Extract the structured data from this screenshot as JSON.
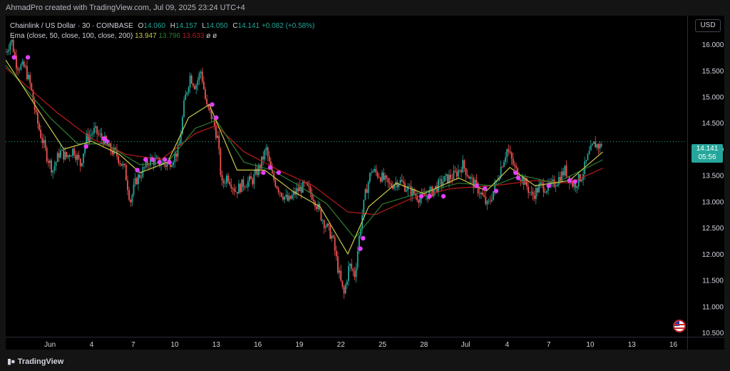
{
  "attribution": "AhmadPro created with TradingView.com, Jul 09, 2025 23:24 UTC+4",
  "legend": {
    "symbol": "Chainlink / US Dollar · 30 · COINBASE",
    "o_label": "O",
    "o_value": "14.060",
    "h_label": "H",
    "h_value": "14.157",
    "l_label": "L",
    "l_value": "14.050",
    "c_label": "C",
    "c_value": "14.141",
    "change": "+0.082 (+0.58%)",
    "ema_label": "Ema (close, 50, close, 100, close, 200)",
    "ema_50": "13.947",
    "ema_100": "13.796",
    "ema_200": "13.633",
    "ema_extra_1": "ø",
    "ema_extra_2": "ø"
  },
  "currency_button": "USD",
  "current_price": "14.141",
  "countdown": "05:56",
  "logo_text": "TradingView",
  "colors": {
    "up": "#26a69a",
    "down": "#ef5350",
    "ema_50": "#c8c84a",
    "ema_100": "#2e7d32",
    "ema_200": "#b71c1c",
    "marker": "#e040fb",
    "price_line": "#26a69a"
  },
  "chart_data": {
    "type": "candlestick",
    "symbol": "LINK/USD",
    "interval": "30",
    "exchange": "COINBASE",
    "y_ticks": [
      10.5,
      11.0,
      11.5,
      12.0,
      12.5,
      13.0,
      13.5,
      14.0,
      14.5,
      15.0,
      15.5,
      16.0
    ],
    "y_tick_labels": [
      "10.500",
      "11.000",
      "11.500",
      "12.000",
      "12.500",
      "13.000",
      "13.500",
      "14.000",
      "14.500",
      "15.000",
      "15.500",
      "16.000"
    ],
    "x_tick_labels": [
      "Jun",
      "4",
      "7",
      "10",
      "13",
      "16",
      "19",
      "22",
      "25",
      "28",
      "Jul",
      "4",
      "7",
      "10",
      "13",
      "16"
    ],
    "x_tick_days": [
      1,
      4,
      7,
      10,
      13,
      16,
      19,
      22,
      25,
      28,
      31,
      34,
      37,
      40,
      43,
      46
    ],
    "x_range_days": [
      -2.2,
      47
    ],
    "y_range": [
      10.42,
      16.3
    ],
    "close_path": [
      {
        "day": -2.2,
        "close": 15.85
      },
      {
        "day": -1.8,
        "close": 16.1
      },
      {
        "day": -1.4,
        "close": 15.6
      },
      {
        "day": -0.8,
        "close": 15.55
      },
      {
        "day": -0.4,
        "close": 15.2
      },
      {
        "day": 0.0,
        "close": 14.6
      },
      {
        "day": 0.4,
        "close": 14.2
      },
      {
        "day": 0.8,
        "close": 13.85
      },
      {
        "day": 1.2,
        "close": 13.6
      },
      {
        "day": 1.7,
        "close": 13.95
      },
      {
        "day": 2.2,
        "close": 13.85
      },
      {
        "day": 2.7,
        "close": 14.0
      },
      {
        "day": 3.2,
        "close": 13.7
      },
      {
        "day": 3.6,
        "close": 14.2
      },
      {
        "day": 4.2,
        "close": 14.35
      },
      {
        "day": 4.8,
        "close": 14.2
      },
      {
        "day": 5.3,
        "close": 14.0
      },
      {
        "day": 5.8,
        "close": 13.9
      },
      {
        "day": 6.4,
        "close": 13.6
      },
      {
        "day": 6.8,
        "close": 13.0
      },
      {
        "day": 7.2,
        "close": 13.4
      },
      {
        "day": 7.6,
        "close": 13.55
      },
      {
        "day": 8.2,
        "close": 13.8
      },
      {
        "day": 8.8,
        "close": 13.75
      },
      {
        "day": 9.4,
        "close": 13.7
      },
      {
        "day": 9.8,
        "close": 13.8
      },
      {
        "day": 10.3,
        "close": 14.0
      },
      {
        "day": 10.7,
        "close": 14.9
      },
      {
        "day": 11.1,
        "close": 15.4
      },
      {
        "day": 11.5,
        "close": 15.2
      },
      {
        "day": 11.9,
        "close": 15.5
      },
      {
        "day": 12.3,
        "close": 14.8
      },
      {
        "day": 12.7,
        "close": 14.6
      },
      {
        "day": 13.1,
        "close": 14.2
      },
      {
        "day": 13.4,
        "close": 13.3
      },
      {
        "day": 13.8,
        "close": 13.5
      },
      {
        "day": 14.4,
        "close": 13.2
      },
      {
        "day": 15.0,
        "close": 13.35
      },
      {
        "day": 15.6,
        "close": 13.4
      },
      {
        "day": 16.2,
        "close": 13.7
      },
      {
        "day": 16.6,
        "close": 14.0
      },
      {
        "day": 17.0,
        "close": 13.5
      },
      {
        "day": 17.6,
        "close": 13.2
      },
      {
        "day": 18.2,
        "close": 13.0
      },
      {
        "day": 18.8,
        "close": 13.2
      },
      {
        "day": 19.4,
        "close": 13.3
      },
      {
        "day": 20.0,
        "close": 13.1
      },
      {
        "day": 20.6,
        "close": 12.7
      },
      {
        "day": 21.0,
        "close": 12.5
      },
      {
        "day": 21.4,
        "close": 12.3
      },
      {
        "day": 21.8,
        "close": 11.7
      },
      {
        "day": 22.2,
        "close": 11.2
      },
      {
        "day": 22.6,
        "close": 11.8
      },
      {
        "day": 23.0,
        "close": 11.6
      },
      {
        "day": 23.4,
        "close": 12.5
      },
      {
        "day": 23.8,
        "close": 13.2
      },
      {
        "day": 24.2,
        "close": 13.6
      },
      {
        "day": 24.8,
        "close": 13.5
      },
      {
        "day": 25.5,
        "close": 13.3
      },
      {
        "day": 26.2,
        "close": 13.4
      },
      {
        "day": 27.0,
        "close": 13.2
      },
      {
        "day": 27.8,
        "close": 13.05
      },
      {
        "day": 28.6,
        "close": 13.2
      },
      {
        "day": 29.4,
        "close": 13.4
      },
      {
        "day": 30.2,
        "close": 13.5
      },
      {
        "day": 30.8,
        "close": 13.7
      },
      {
        "day": 31.4,
        "close": 13.4
      },
      {
        "day": 32.0,
        "close": 13.2
      },
      {
        "day": 32.6,
        "close": 12.9
      },
      {
        "day": 33.0,
        "close": 13.2
      },
      {
        "day": 33.6,
        "close": 13.7
      },
      {
        "day": 34.0,
        "close": 14.0
      },
      {
        "day": 34.6,
        "close": 13.6
      },
      {
        "day": 35.2,
        "close": 13.4
      },
      {
        "day": 35.8,
        "close": 13.1
      },
      {
        "day": 36.4,
        "close": 13.3
      },
      {
        "day": 37.0,
        "close": 13.25
      },
      {
        "day": 37.6,
        "close": 13.4
      },
      {
        "day": 38.2,
        "close": 13.6
      },
      {
        "day": 38.8,
        "close": 13.3
      },
      {
        "day": 39.4,
        "close": 13.5
      },
      {
        "day": 39.9,
        "close": 13.9
      },
      {
        "day": 40.3,
        "close": 14.1
      },
      {
        "day": 40.7,
        "close": 14.05
      },
      {
        "day": 40.9,
        "close": 14.141
      }
    ],
    "ema_50": [
      {
        "day": -2.2,
        "close": 15.7
      },
      {
        "day": 0.5,
        "close": 14.6
      },
      {
        "day": 2.0,
        "close": 14.0
      },
      {
        "day": 4.0,
        "close": 14.15
      },
      {
        "day": 6.0,
        "close": 13.9
      },
      {
        "day": 7.5,
        "close": 13.55
      },
      {
        "day": 9.5,
        "close": 13.75
      },
      {
        "day": 11.0,
        "close": 14.6
      },
      {
        "day": 12.5,
        "close": 14.85
      },
      {
        "day": 14.5,
        "close": 13.6
      },
      {
        "day": 16.5,
        "close": 13.6
      },
      {
        "day": 18.5,
        "close": 13.2
      },
      {
        "day": 20.5,
        "close": 12.9
      },
      {
        "day": 22.5,
        "close": 12.0
      },
      {
        "day": 24.0,
        "close": 12.9
      },
      {
        "day": 26.0,
        "close": 13.35
      },
      {
        "day": 28.0,
        "close": 13.15
      },
      {
        "day": 30.5,
        "close": 13.45
      },
      {
        "day": 32.5,
        "close": 13.2
      },
      {
        "day": 34.2,
        "close": 13.65
      },
      {
        "day": 36.0,
        "close": 13.3
      },
      {
        "day": 38.5,
        "close": 13.4
      },
      {
        "day": 40.9,
        "close": 13.947
      }
    ],
    "ema_100": [
      {
        "day": -2.2,
        "close": 15.6
      },
      {
        "day": 1.0,
        "close": 14.6
      },
      {
        "day": 3.0,
        "close": 14.1
      },
      {
        "day": 5.0,
        "close": 14.1
      },
      {
        "day": 7.5,
        "close": 13.7
      },
      {
        "day": 9.5,
        "close": 13.75
      },
      {
        "day": 11.5,
        "close": 14.4
      },
      {
        "day": 13.0,
        "close": 14.55
      },
      {
        "day": 15.0,
        "close": 13.75
      },
      {
        "day": 17.0,
        "close": 13.6
      },
      {
        "day": 19.0,
        "close": 13.3
      },
      {
        "day": 21.0,
        "close": 12.95
      },
      {
        "day": 23.0,
        "close": 12.3
      },
      {
        "day": 25.0,
        "close": 12.95
      },
      {
        "day": 27.5,
        "close": 13.15
      },
      {
        "day": 30.5,
        "close": 13.35
      },
      {
        "day": 33.0,
        "close": 13.3
      },
      {
        "day": 35.0,
        "close": 13.5
      },
      {
        "day": 37.5,
        "close": 13.35
      },
      {
        "day": 40.9,
        "close": 13.796
      }
    ],
    "ema_200": [
      {
        "day": -2.2,
        "close": 15.55
      },
      {
        "day": 1.5,
        "close": 14.7
      },
      {
        "day": 4.0,
        "close": 14.2
      },
      {
        "day": 6.5,
        "close": 13.9
      },
      {
        "day": 9.0,
        "close": 13.8
      },
      {
        "day": 11.5,
        "close": 14.3
      },
      {
        "day": 13.0,
        "close": 14.45
      },
      {
        "day": 15.0,
        "close": 13.95
      },
      {
        "day": 17.5,
        "close": 13.6
      },
      {
        "day": 20.0,
        "close": 13.3
      },
      {
        "day": 22.5,
        "close": 12.8
      },
      {
        "day": 24.5,
        "close": 12.75
      },
      {
        "day": 27.0,
        "close": 13.05
      },
      {
        "day": 30.0,
        "close": 13.25
      },
      {
        "day": 33.0,
        "close": 13.3
      },
      {
        "day": 36.0,
        "close": 13.4
      },
      {
        "day": 38.5,
        "close": 13.35
      },
      {
        "day": 40.9,
        "close": 13.633
      }
    ],
    "markers": [
      {
        "day": -1.6,
        "price": 15.75
      },
      {
        "day": -0.6,
        "price": 15.75
      },
      {
        "day": 3.6,
        "price": 14.05
      },
      {
        "day": 4.9,
        "price": 14.2
      },
      {
        "day": 5.1,
        "price": 14.15
      },
      {
        "day": 7.3,
        "price": 13.6
      },
      {
        "day": 7.9,
        "price": 13.8
      },
      {
        "day": 8.4,
        "price": 13.8
      },
      {
        "day": 8.9,
        "price": 13.75
      },
      {
        "day": 9.3,
        "price": 13.8
      },
      {
        "day": 9.6,
        "price": 13.75
      },
      {
        "day": 12.7,
        "price": 14.85
      },
      {
        "day": 13.0,
        "price": 14.6
      },
      {
        "day": 16.4,
        "price": 13.55
      },
      {
        "day": 16.9,
        "price": 13.65
      },
      {
        "day": 17.5,
        "price": 13.55
      },
      {
        "day": 23.4,
        "price": 12.1
      },
      {
        "day": 23.6,
        "price": 12.3
      },
      {
        "day": 27.8,
        "price": 13.1
      },
      {
        "day": 28.4,
        "price": 13.1
      },
      {
        "day": 29.4,
        "price": 13.1
      },
      {
        "day": 31.8,
        "price": 13.3
      },
      {
        "day": 32.4,
        "price": 13.25
      },
      {
        "day": 33.2,
        "price": 13.2
      },
      {
        "day": 34.6,
        "price": 13.55
      },
      {
        "day": 34.8,
        "price": 13.45
      },
      {
        "day": 37.0,
        "price": 13.3
      },
      {
        "day": 38.5,
        "price": 13.4
      },
      {
        "day": 38.9,
        "price": 13.38
      }
    ]
  }
}
